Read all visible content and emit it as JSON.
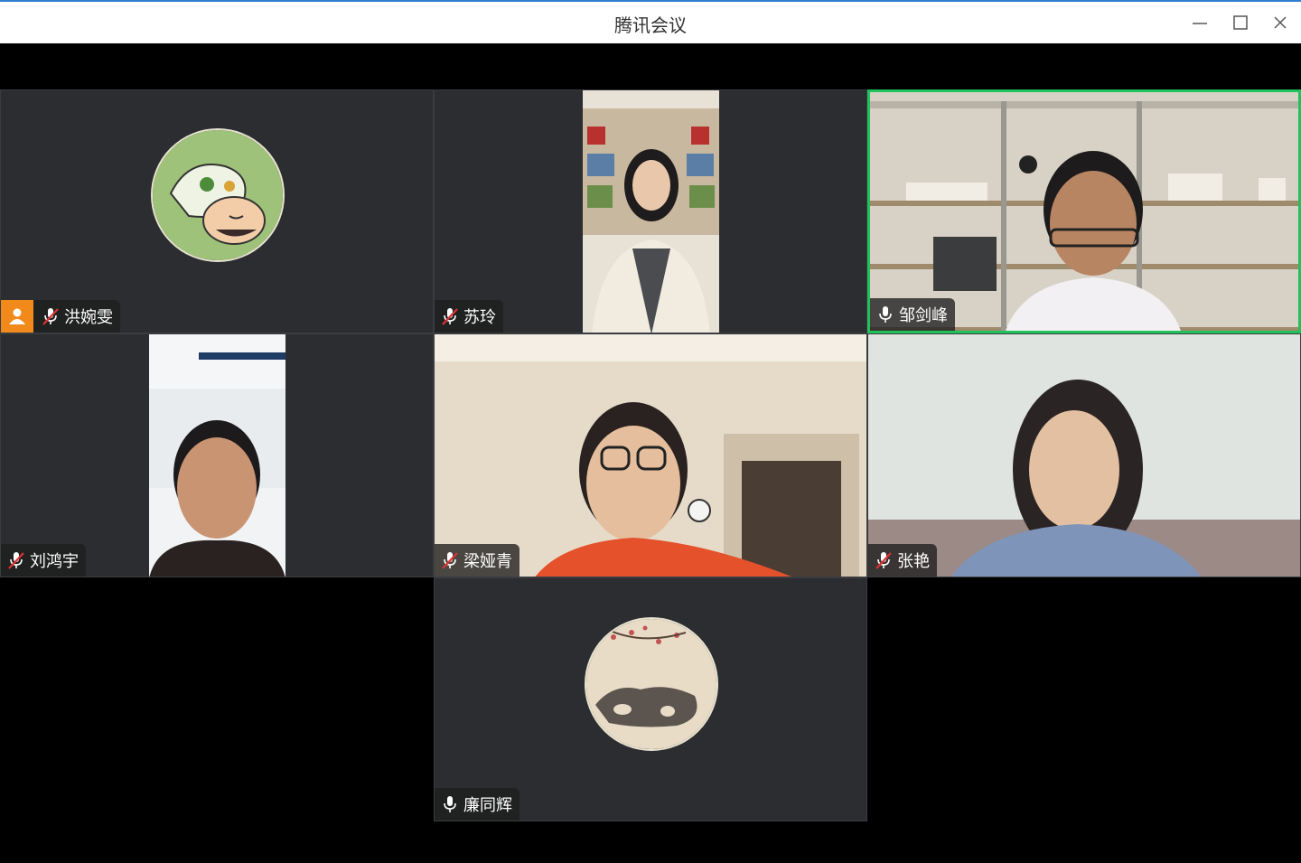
{
  "window": {
    "title": "腾讯会议",
    "controls": [
      "minimize-icon",
      "maximize-icon",
      "close-icon"
    ]
  },
  "participants": [
    {
      "name": "洪婉雯",
      "mic": "muted",
      "video": "off",
      "avatar": "cartoon-sleeping-child-avatar",
      "host": true
    },
    {
      "name": "苏玲",
      "mic": "muted",
      "video": "on"
    },
    {
      "name": "邹剑峰",
      "mic": "on",
      "video": "on",
      "speaking": true
    },
    {
      "name": "刘鸿宇",
      "mic": "muted",
      "video": "on"
    },
    {
      "name": "梁娅青",
      "mic": "muted",
      "video": "on"
    },
    {
      "name": "张艳",
      "mic": "muted",
      "video": "on"
    },
    {
      "name": "廉同辉",
      "mic": "on",
      "video": "off",
      "avatar": "ink-painting-ox-avatar"
    }
  ],
  "colors": {
    "active_speaker_border": "#1fc25b",
    "host_badge": "#f28a1b",
    "tile_background": "#2b2d30",
    "muted_icon": "#e03131"
  }
}
